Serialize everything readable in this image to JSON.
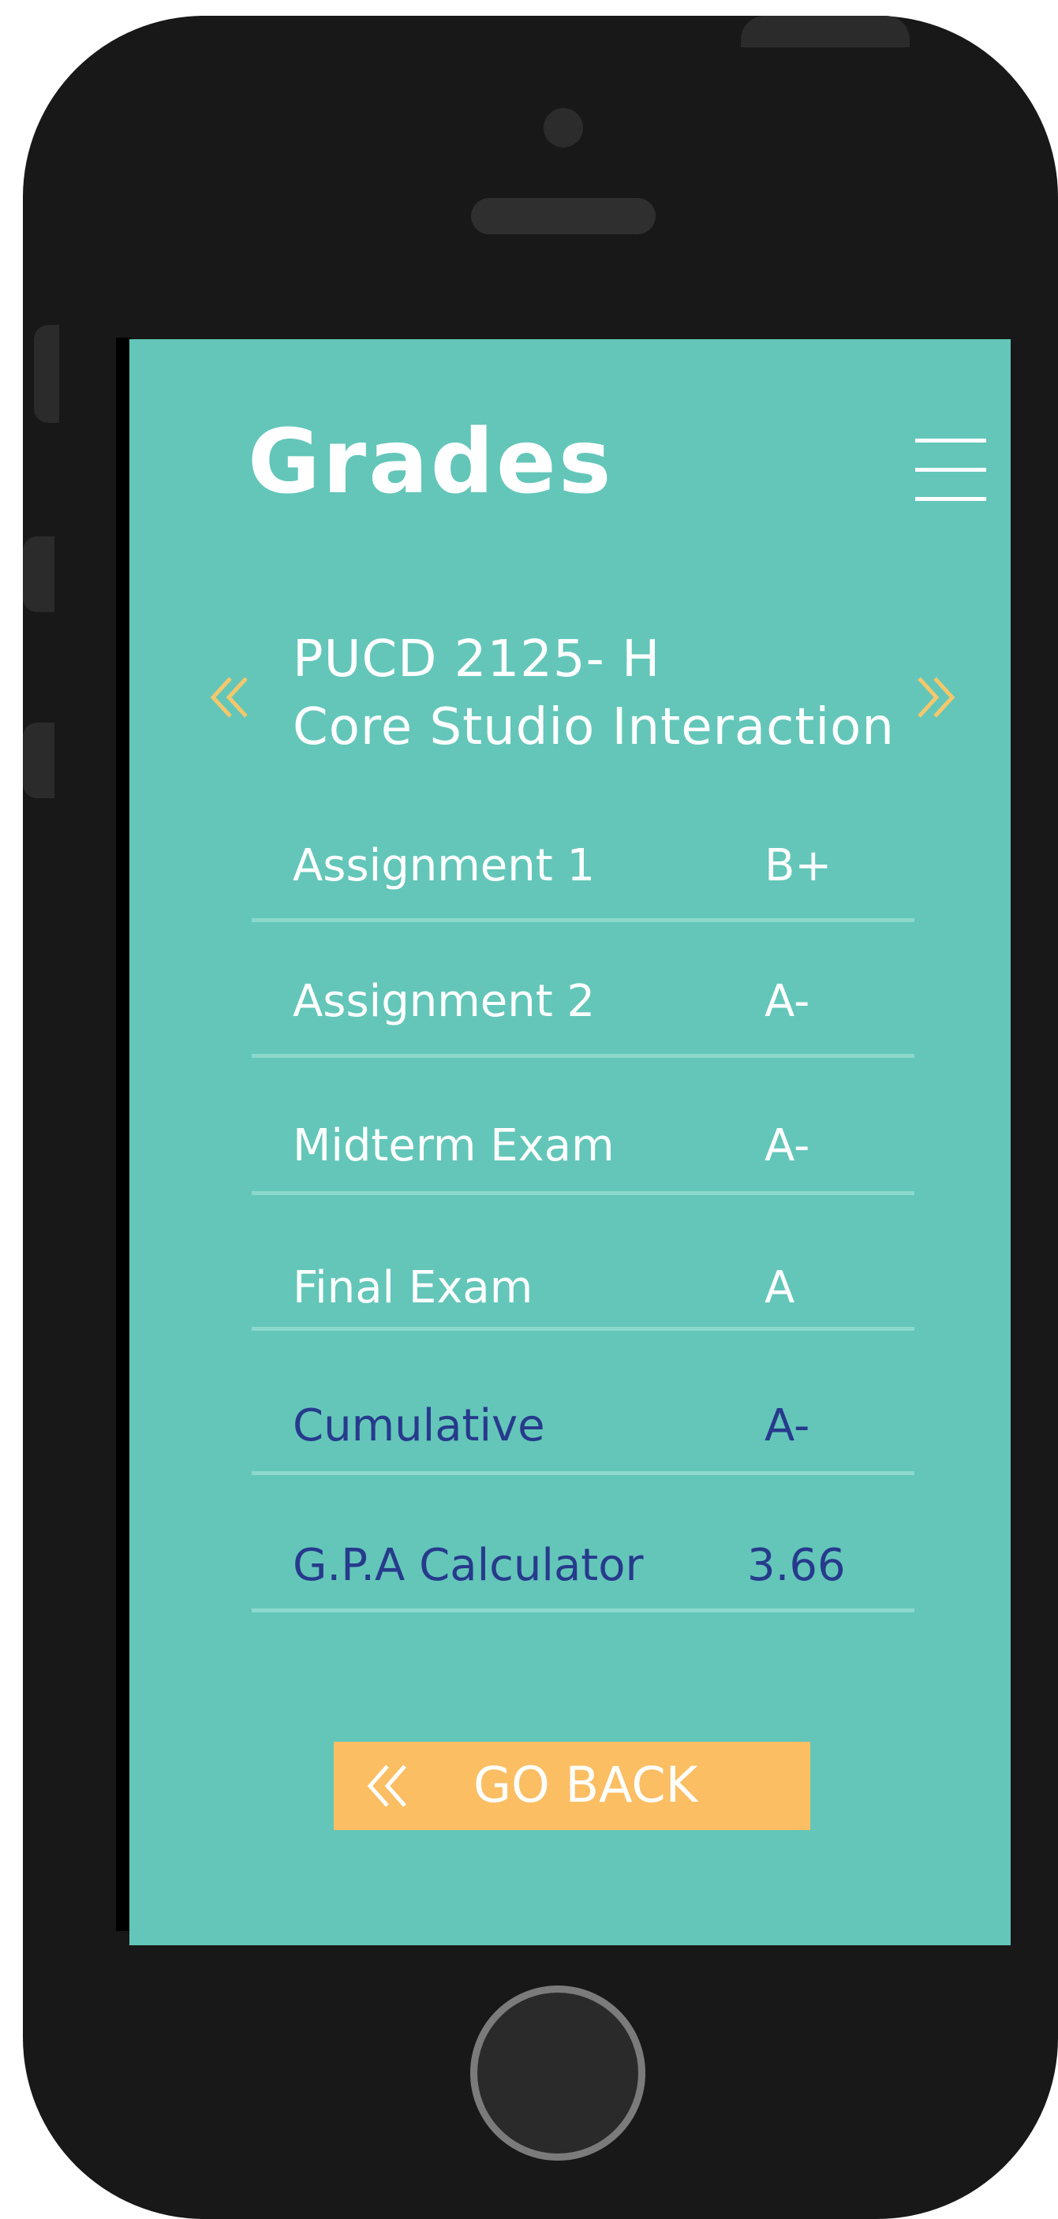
{
  "header": {
    "title": "Grades",
    "menu_icon": "hamburger-menu-icon"
  },
  "course": {
    "code": "PUCD 2125- H",
    "name": "Core Studio Interaction",
    "prev_icon": "chevron-double-left-icon",
    "next_icon": "chevron-double-right-icon",
    "chevron_color": "#f4c76b"
  },
  "grades": [
    {
      "label": "Assignment 1",
      "value": "B+"
    },
    {
      "label": "Assignment 2",
      "value": "A-"
    },
    {
      "label": "Midterm Exam",
      "value": "A-"
    },
    {
      "label": "Final Exam",
      "value": "A"
    },
    {
      "label": "Cumulative",
      "value": "A-"
    },
    {
      "label": "G.P.A Calculator",
      "value": "3.66"
    }
  ],
  "go_back": {
    "label": "GO BACK",
    "icon": "chevron-double-left-icon"
  },
  "colors": {
    "screen": "#63c6b9",
    "accent": "#fbbe63",
    "summary_text": "#273a8c",
    "phone_body": "#181818"
  }
}
